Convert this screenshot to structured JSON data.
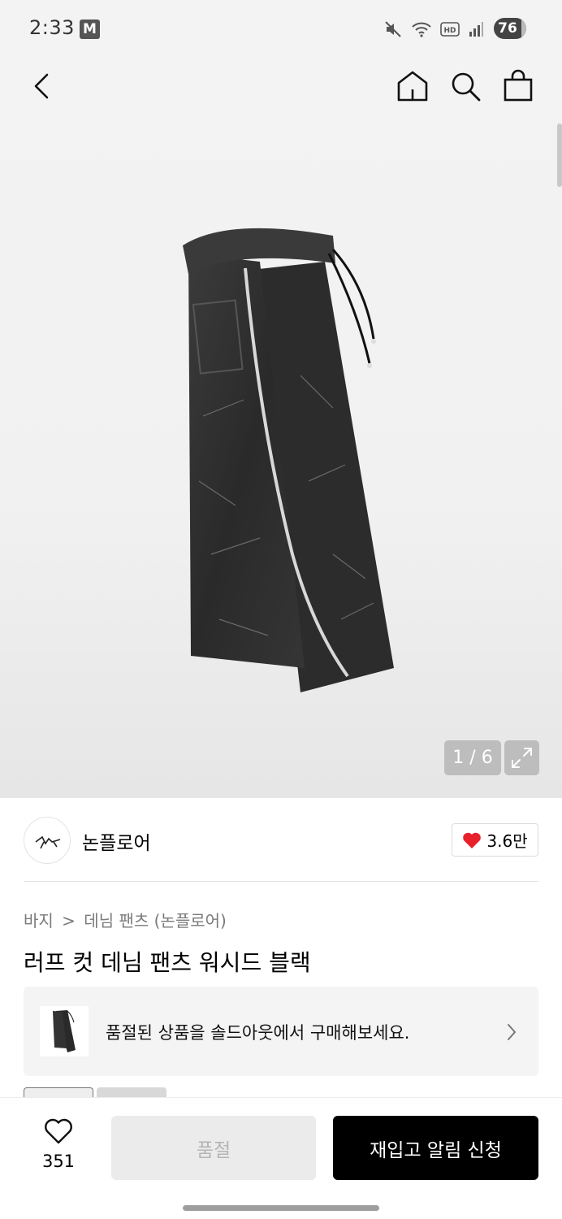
{
  "status_bar": {
    "time": "2:33",
    "badge": "M",
    "battery": "76"
  },
  "gallery": {
    "counter": "1 / 6"
  },
  "brand": {
    "name": "논플로어",
    "likes": "3.6만"
  },
  "product": {
    "breadcrumb_category": "바지",
    "breadcrumb_separator": ">",
    "breadcrumb_sub": "데님 팬츠 (논플로어)",
    "title": "러프 컷 데님 팬츠 워시드 블랙"
  },
  "soldout_banner": {
    "text": "품절된 상품을 솔드아웃에서 구매해보세요."
  },
  "bottom_bar": {
    "wish_count": "351",
    "soldout_label": "품절",
    "restock_label": "재입고 알림 신청"
  },
  "colors": {
    "accent": "#000000",
    "heart": "#e8202a",
    "disabled": "#ebebeb"
  }
}
